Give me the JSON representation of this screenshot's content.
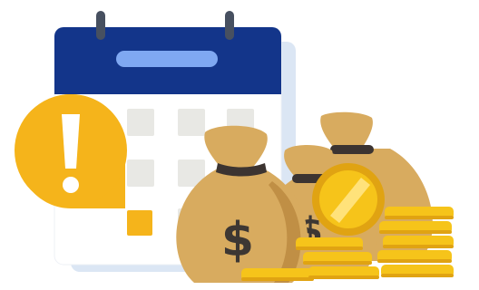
{
  "illustration": {
    "alert_symbol": "!",
    "currency_symbol": "$",
    "icons": {
      "calendar": "calendar-icon",
      "alert": "exclamation-speech-bubble-icon",
      "money_bag": "money-bag-icon",
      "coin": "coin-icon"
    },
    "colors": {
      "calendar_header": "#13358a",
      "calendar_body": "#ffffff",
      "calendar_shadow": "#dbe6f4",
      "calendar_slot": "#e8e8e4",
      "highlight_slot": "#f5b41b",
      "calendar_pill": "#7fa8f2",
      "ring": "#475060",
      "alert_bubble": "#f5b41b",
      "money_bag": "#d8ab5f",
      "money_bag_dark": "#c08f45",
      "bag_tie": "#3c3431",
      "coin_gold": "#f6c41a",
      "coin_dark": "#e0a312",
      "dollar_sign": "#3d3733"
    }
  }
}
